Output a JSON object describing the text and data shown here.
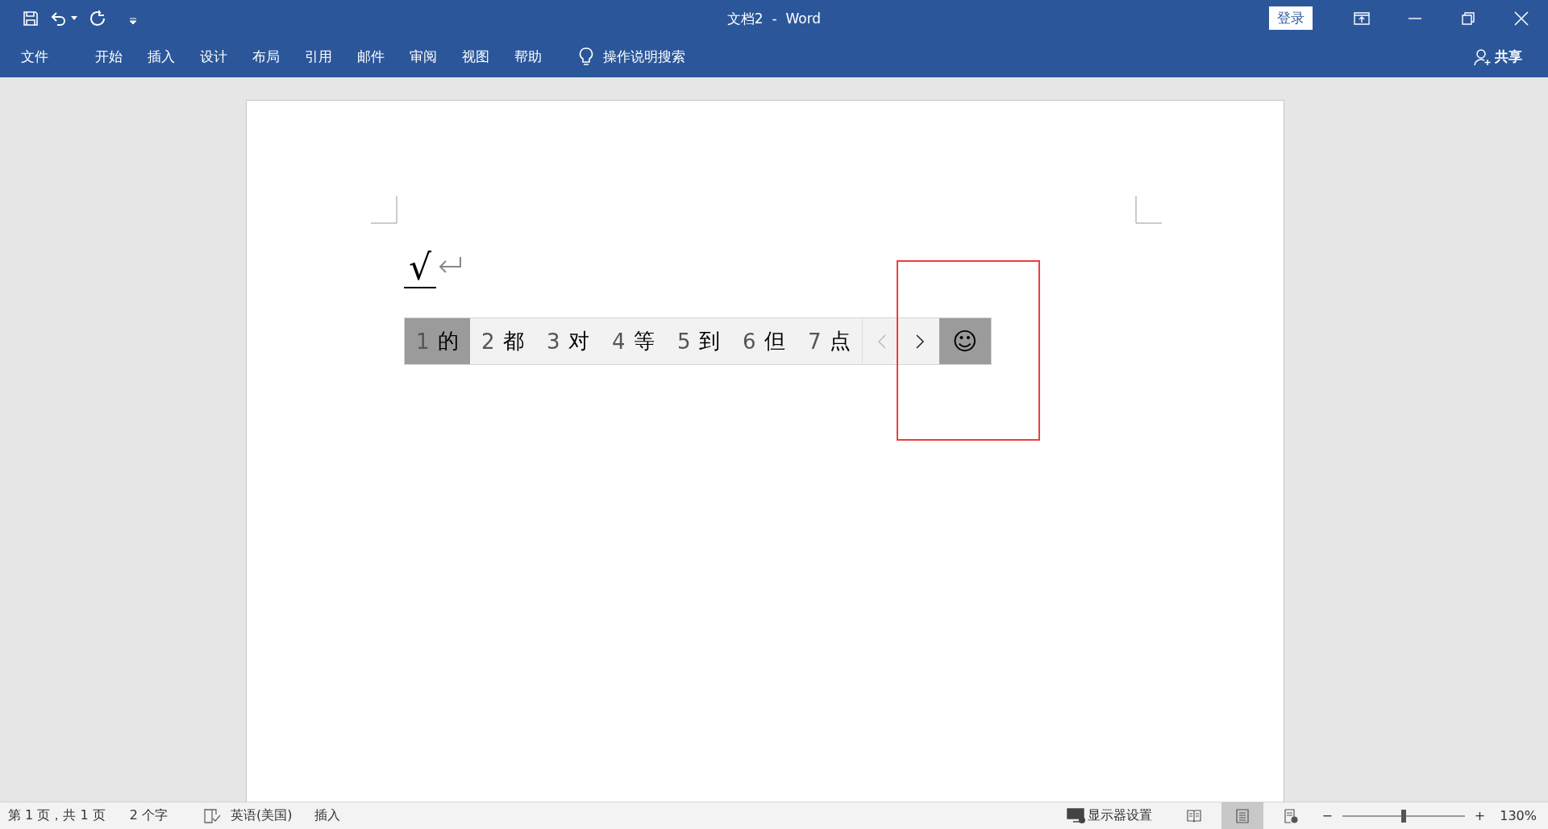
{
  "window": {
    "title": "文档2  -  Word",
    "login": "登录"
  },
  "ribbon_tabs": [
    {
      "label": "文件"
    },
    {
      "label": "开始"
    },
    {
      "label": "插入"
    },
    {
      "label": "设计"
    },
    {
      "label": "布局"
    },
    {
      "label": "引用"
    },
    {
      "label": "邮件"
    },
    {
      "label": "审阅"
    },
    {
      "label": "视图"
    },
    {
      "label": "帮助"
    }
  ],
  "tell_me": {
    "placeholder": "操作说明搜索"
  },
  "share": "共享",
  "document": {
    "text": "√"
  },
  "ime": {
    "candidates": [
      {
        "number": "1",
        "text": "的",
        "selected": true
      },
      {
        "number": "2",
        "text": "都",
        "selected": false
      },
      {
        "number": "3",
        "text": "对",
        "selected": false
      },
      {
        "number": "4",
        "text": "等",
        "selected": false
      },
      {
        "number": "5",
        "text": "到",
        "selected": false
      },
      {
        "number": "6",
        "text": "但",
        "selected": false
      },
      {
        "number": "7",
        "text": "点",
        "selected": false
      }
    ],
    "prev_disabled": true,
    "next_disabled": false,
    "emoji": "☺"
  },
  "status_bar": {
    "page": "第 1 页，共 1 页",
    "words": "2 个字",
    "language": "英语(美国)",
    "mode": "插入",
    "display": "显示器设置",
    "views": [
      {
        "kind": "read",
        "selected": false
      },
      {
        "kind": "print",
        "selected": true
      },
      {
        "kind": "web",
        "selected": false
      }
    ],
    "zoom_out": "−",
    "zoom_in": "+",
    "zoom": {
      "level": 0.5
    },
    "zoom_label": "130%"
  }
}
